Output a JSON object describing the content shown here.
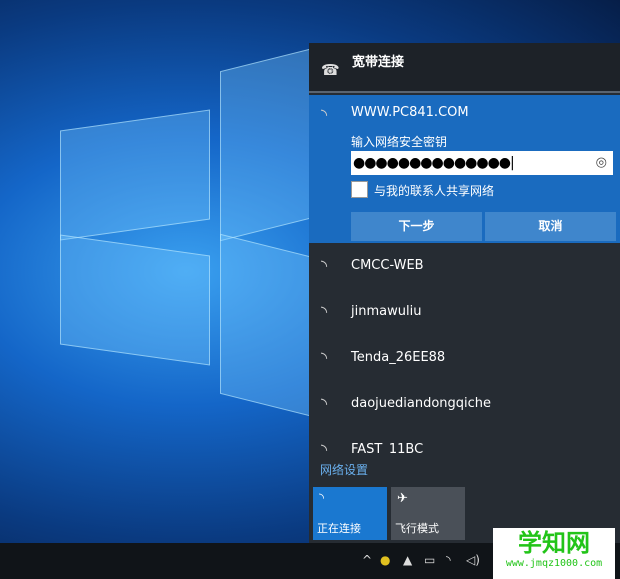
{
  "broadband": {
    "label": "宽带连接"
  },
  "selected": {
    "ssid": "WWW.PC841.COM",
    "key_label": "输入网络安全密钥",
    "password_masked": "●●●●●●●●●●●●●●",
    "share_label": "与我的联系人共享网络",
    "share_checked": false,
    "next_label": "下一步",
    "cancel_label": "取消"
  },
  "networks": [
    {
      "ssid": "CMCC-WEB",
      "secured": false
    },
    {
      "ssid": "jinmawuliu"
    },
    {
      "ssid": "Tenda_26EE88"
    },
    {
      "ssid": "daojuediandongqiche"
    },
    {
      "ssid": "FAST_11BC"
    }
  ],
  "network_settings": "网络设置",
  "tiles": [
    {
      "label": "正在连接",
      "active": true
    },
    {
      "label": "飞行模式",
      "active": false
    }
  ],
  "watermark": {
    "title": "学知网",
    "url": "www.jmqz1000.com"
  }
}
